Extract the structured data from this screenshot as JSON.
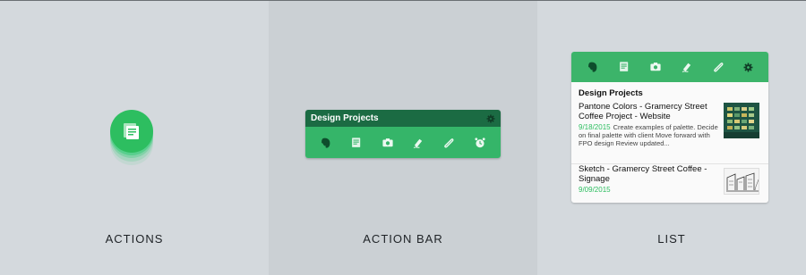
{
  "panels": [
    {
      "caption": "ACTIONS"
    },
    {
      "caption": "ACTION BAR"
    },
    {
      "caption": "LIST"
    }
  ],
  "fab": {
    "icon": "note-stack-icon"
  },
  "action_bar": {
    "title": "Design Projects",
    "settings_icon": "gear-icon",
    "icons": [
      "elephant-icon",
      "note-icon",
      "camera-icon",
      "handwriting-icon",
      "attachment-icon",
      "reminder-icon"
    ]
  },
  "list": {
    "toolbar_icons": [
      "elephant-icon",
      "note-icon",
      "camera-icon",
      "handwriting-icon",
      "attachment-icon",
      "gear-icon"
    ],
    "heading": "Design Projects",
    "notes": [
      {
        "title": "Pantone Colors - Gramercy Street Coffee Project - Website",
        "date": "9/18/2015",
        "snippet": "Create examples of palette. Decide on final palette with client Move forward with FPO design Review updated..."
      },
      {
        "title": "Sketch - Gramercy Street Coffee - Signage",
        "date": "9/09/2015"
      }
    ]
  },
  "colors": {
    "green": "#2dbe60",
    "dark_green": "#1b6b43",
    "bar_green": "#35b569"
  }
}
